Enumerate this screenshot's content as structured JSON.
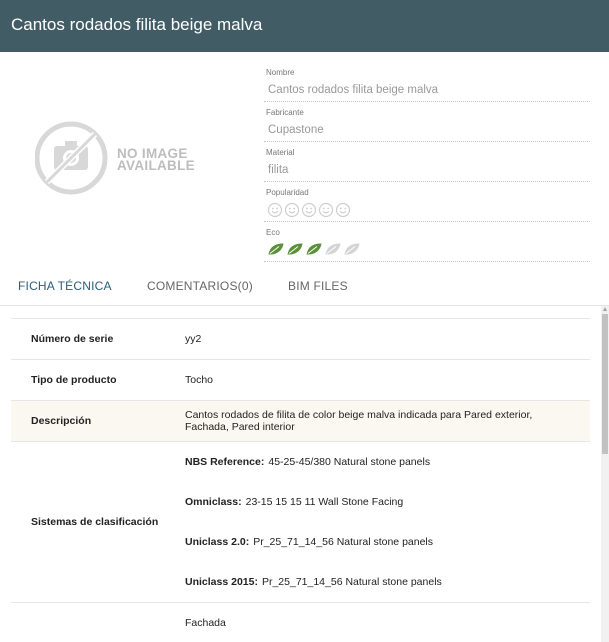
{
  "header": {
    "title": "Cantos rodados filita beige malva"
  },
  "image_placeholder": {
    "line1": "NO IMAGE",
    "line2": "AVAILABLE"
  },
  "fields": {
    "nombre": {
      "label": "Nombre",
      "value": "Cantos rodados filita beige malva"
    },
    "fabricante": {
      "label": "Fabricante",
      "value": "Cupastone"
    },
    "material": {
      "label": "Material",
      "value": "filita"
    },
    "popularidad": {
      "label": "Popularidad",
      "value": 0,
      "max": 5,
      "icon": "smiley-icon"
    },
    "eco": {
      "label": "Eco",
      "value": 3,
      "max": 5,
      "icon": "leaf-icon",
      "active_color": "#5b8f3a",
      "inactive_color": "#d4d4d4"
    }
  },
  "tabs": [
    {
      "label": "FICHA TÉCNICA",
      "active": true
    },
    {
      "label": "COMENTARIOS(0)",
      "active": false
    },
    {
      "label": "BIM FILES",
      "active": false
    }
  ],
  "spec": {
    "serie": {
      "key": "Número de serie",
      "value": "yy2"
    },
    "tipo": {
      "key": "Tipo de producto",
      "value": "Tocho"
    },
    "descripcion": {
      "key": "Descripción",
      "value": "Cantos rodados de filita de color beige malva indicada para Pared exterior, Fachada, Pared interior"
    },
    "sistemas": {
      "key": "Sistemas de clasificación",
      "items": [
        {
          "label": "NBS Reference:",
          "value": "45-25-45/380 Natural stone panels"
        },
        {
          "label": "Omniclass:",
          "value": "23-15 15 15 11 Wall Stone Facing"
        },
        {
          "label": "Uniclass 2.0:",
          "value": "Pr_25_71_14_56 Natural stone panels"
        },
        {
          "label": "Uniclass 2015:",
          "value": "Pr_25_71_14_56 Natural stone panels"
        }
      ]
    },
    "uso": {
      "value": "Fachada"
    }
  },
  "colors": {
    "header_bg": "#425c66",
    "tab_active": "#2a5e7a",
    "row_highlight": "#fbf8f1"
  }
}
